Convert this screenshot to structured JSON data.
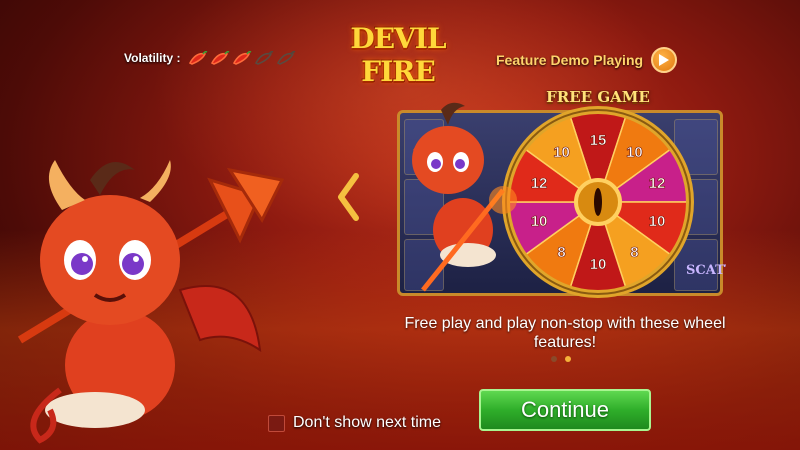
{
  "header": {
    "volatility_label": "Volatility :",
    "volatility_level": 3,
    "volatility_max": 5,
    "logo_text": "DEVIL FIRE",
    "demo_label": "Feature Demo Playing",
    "demo_icon": "play-icon"
  },
  "preview": {
    "banner": "FREE GAME",
    "scatter_text": "SCATTER",
    "wheel_segments": [
      "15",
      "10",
      "12",
      "10",
      "8",
      "10",
      "8",
      "10",
      "12",
      "10"
    ]
  },
  "caption": "Free play and play non-stop with these wheel features!",
  "pagination": {
    "total": 2,
    "current": 2
  },
  "footer": {
    "dont_show_label": "Don't show next time",
    "continue_label": "Continue"
  },
  "colors": {
    "continue_green": "#2fae2a",
    "accent_orange": "#f5b23a",
    "background_red": "#8e1a10"
  }
}
